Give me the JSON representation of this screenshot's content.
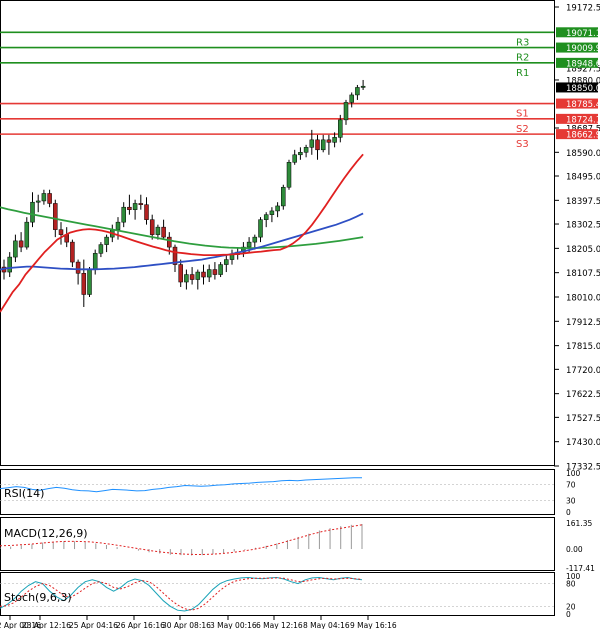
{
  "chart_data": {
    "type": "candlestick",
    "main": {
      "ylim": [
        17332.5,
        19172.5
      ],
      "y_ticks": [
        "19172.5",
        "18880.0",
        "18785.4",
        "18687.5",
        "18590.0",
        "18495.0",
        "18397.5",
        "18302.5",
        "18205.0",
        "18107.5",
        "18010.0",
        "17912.5",
        "17815.0",
        "17720.0",
        "17622.5",
        "17527.5",
        "17430.0",
        "17332.5"
      ],
      "current_price": "18850.0",
      "levels": [
        {
          "name": "R3",
          "value": 19071.1,
          "label": "19071.1",
          "color": "#1f8f1f",
          "text_color": "#1f8f1f"
        },
        {
          "name": "R2",
          "value": 19009.9,
          "label": "19009.9",
          "color": "#1f8f1f",
          "text_color": "#1f8f1f"
        },
        {
          "name": "R1",
          "value": 18948.6,
          "label": "18948.6",
          "color": "#1f8f1f",
          "text_color": "#1f8f1f"
        },
        {
          "name": "S1",
          "value": 18785.4,
          "label": "18785.4",
          "color": "#e53935",
          "text_color": "#e53935"
        },
        {
          "name": "S2",
          "value": 18724.1,
          "label": "18724.1",
          "color": "#e53935",
          "text_color": "#e53935"
        },
        {
          "name": "S3",
          "value": 18662.9,
          "label": "18662.9",
          "color": "#e53935",
          "text_color": "#e53935"
        }
      ],
      "extra_tick_labels": [
        "18927.5"
      ],
      "candles": [
        [
          18130,
          18160,
          18080,
          18110
        ],
        [
          18110,
          18190,
          18090,
          18170
        ],
        [
          18170,
          18260,
          18150,
          18235
        ],
        [
          18235,
          18270,
          18190,
          18210
        ],
        [
          18210,
          18330,
          18200,
          18310
        ],
        [
          18310,
          18430,
          18290,
          18390
        ],
        [
          18390,
          18420,
          18350,
          18395
        ],
        [
          18395,
          18440,
          18380,
          18425
        ],
        [
          18425,
          18440,
          18370,
          18385
        ],
        [
          18385,
          18400,
          18250,
          18280
        ],
        [
          18280,
          18310,
          18220,
          18260
        ],
        [
          18260,
          18290,
          18210,
          18230
        ],
        [
          18230,
          18240,
          18130,
          18150
        ],
        [
          18150,
          18160,
          18060,
          18105
        ],
        [
          18105,
          18160,
          17970,
          18020
        ],
        [
          18020,
          18130,
          18010,
          18120
        ],
        [
          18120,
          18200,
          18100,
          18185
        ],
        [
          18185,
          18230,
          18170,
          18220
        ],
        [
          18220,
          18260,
          18190,
          18250
        ],
        [
          18250,
          18300,
          18230,
          18280
        ],
        [
          18280,
          18330,
          18240,
          18310
        ],
        [
          18310,
          18390,
          18290,
          18370
        ],
        [
          18370,
          18420,
          18340,
          18360
        ],
        [
          18360,
          18400,
          18320,
          18385
        ],
        [
          18385,
          18420,
          18360,
          18380
        ],
        [
          18380,
          18410,
          18300,
          18320
        ],
        [
          18320,
          18340,
          18240,
          18260
        ],
        [
          18260,
          18300,
          18240,
          18290
        ],
        [
          18290,
          18320,
          18240,
          18250
        ],
        [
          18250,
          18270,
          18180,
          18210
        ],
        [
          18210,
          18220,
          18110,
          18140
        ],
        [
          18140,
          18160,
          18050,
          18070
        ],
        [
          18070,
          18120,
          18040,
          18100
        ],
        [
          18100,
          18130,
          18060,
          18080
        ],
        [
          18080,
          18120,
          18040,
          18110
        ],
        [
          18110,
          18140,
          18060,
          18090
        ],
        [
          18090,
          18140,
          18070,
          18120
        ],
        [
          18120,
          18150,
          18080,
          18100
        ],
        [
          18100,
          18150,
          18090,
          18140
        ],
        [
          18140,
          18180,
          18110,
          18160
        ],
        [
          18160,
          18200,
          18140,
          18180
        ],
        [
          18180,
          18210,
          18160,
          18190
        ],
        [
          18190,
          18230,
          18170,
          18210
        ],
        [
          18210,
          18250,
          18190,
          18230
        ],
        [
          18230,
          18260,
          18200,
          18250
        ],
        [
          18250,
          18330,
          18230,
          18320
        ],
        [
          18320,
          18350,
          18290,
          18340
        ],
        [
          18340,
          18370,
          18310,
          18355
        ],
        [
          18355,
          18390,
          18330,
          18375
        ],
        [
          18375,
          18460,
          18360,
          18450
        ],
        [
          18450,
          18560,
          18440,
          18550
        ],
        [
          18550,
          18600,
          18540,
          18580
        ],
        [
          18580,
          18610,
          18560,
          18590
        ],
        [
          18590,
          18620,
          18570,
          18610
        ],
        [
          18610,
          18680,
          18580,
          18640
        ],
        [
          18640,
          18660,
          18560,
          18600
        ],
        [
          18600,
          18660,
          18590,
          18640
        ],
        [
          18640,
          18660,
          18580,
          18630
        ],
        [
          18630,
          18670,
          18610,
          18650
        ],
        [
          18650,
          18740,
          18630,
          18720
        ],
        [
          18720,
          18800,
          18700,
          18790
        ],
        [
          18790,
          18830,
          18770,
          18820
        ],
        [
          18820,
          18860,
          18800,
          18850
        ],
        [
          18850,
          18880,
          18840,
          18855
        ]
      ],
      "sma_red": [
        17950,
        17990,
        18030,
        18060,
        18100,
        18130,
        18160,
        18190,
        18215,
        18240,
        18255,
        18268,
        18275,
        18280,
        18282,
        18280,
        18276,
        18270,
        18262,
        18254,
        18245,
        18236,
        18228,
        18220,
        18212,
        18205,
        18198,
        18192,
        18188,
        18185,
        18182,
        18180,
        18178,
        18178,
        18178,
        18179,
        18180,
        18182,
        18184,
        18187,
        18190,
        18192,
        18195,
        18198,
        18200,
        18210,
        18225,
        18245,
        18270,
        18300,
        18335,
        18372,
        18410,
        18448,
        18485,
        18520,
        18552,
        18582
      ],
      "sma_blue": [
        18120,
        18125,
        18128,
        18130,
        18132,
        18132,
        18130,
        18128,
        18126,
        18124,
        18123,
        18122,
        18121,
        18121,
        18121,
        18122,
        18123,
        18124,
        18126,
        18128,
        18130,
        18133,
        18136,
        18139,
        18142,
        18145,
        18148,
        18151,
        18154,
        18157,
        18160,
        18165,
        18170,
        18175,
        18180,
        18186,
        18192,
        18198,
        18205,
        18212,
        18220,
        18228,
        18236,
        18244,
        18252,
        18260,
        18268,
        18276,
        18284,
        18292,
        18300,
        18310,
        18320,
        18332,
        18345
      ],
      "sma_green": [
        18370,
        18362,
        18355,
        18348,
        18342,
        18336,
        18330,
        18324,
        18318,
        18312,
        18306,
        18300,
        18294,
        18288,
        18282,
        18276,
        18270,
        18264,
        18258,
        18252,
        18246,
        18240,
        18234,
        18229,
        18224,
        18220,
        18216,
        18213,
        18210,
        18208,
        18207,
        18206,
        18206,
        18207,
        18208,
        18210,
        18212,
        18214,
        18217,
        18220,
        18223,
        18227,
        18231,
        18235,
        18240,
        18245,
        18250
      ]
    },
    "rsi": {
      "label": "RSI(14)",
      "ticks": [
        "100",
        "70",
        "30",
        "0"
      ],
      "values": [
        60,
        62,
        65,
        63,
        58,
        56,
        60,
        63,
        61,
        57,
        55,
        54,
        52,
        55,
        58,
        57,
        56,
        54,
        55,
        58,
        60,
        63,
        65,
        68,
        67,
        66,
        67,
        69,
        70,
        72,
        73,
        74,
        76,
        77,
        78,
        80,
        81,
        80,
        82,
        83,
        84,
        85,
        86,
        87,
        88,
        88
      ]
    },
    "macd": {
      "label": "MACD(12,26,9)",
      "ticks": [
        "161.35",
        "0.00",
        "-117.41"
      ],
      "histogram": [
        10,
        15,
        22,
        30,
        40,
        45,
        50,
        48,
        42,
        35,
        25,
        12,
        0,
        -10,
        -20,
        -28,
        -35,
        -38,
        -40,
        -38,
        -32,
        -25,
        -15,
        -5,
        8,
        20,
        35,
        55,
        75,
        95,
        115,
        130,
        142,
        150,
        155
      ],
      "signal": [
        20,
        22,
        26,
        30,
        36,
        42,
        46,
        48,
        47,
        44,
        38,
        30,
        20,
        10,
        0,
        -10,
        -18,
        -25,
        -30,
        -33,
        -34,
        -32,
        -28,
        -22,
        -14,
        -4,
        8,
        22,
        38,
        56,
        74,
        92,
        108,
        120,
        130,
        140,
        150
      ]
    },
    "stoch": {
      "label": "Stoch(9,6,3)",
      "ticks": [
        "100",
        "80",
        "20",
        "0"
      ],
      "k": [
        15,
        25,
        40,
        60,
        75,
        85,
        80,
        60,
        45,
        35,
        50,
        70,
        85,
        90,
        85,
        70,
        60,
        70,
        85,
        92,
        88,
        75,
        55,
        35,
        20,
        10,
        8,
        12,
        25,
        45,
        65,
        80,
        88,
        92,
        95,
        96,
        94,
        93,
        95,
        96,
        92,
        85,
        80,
        90,
        95,
        96,
        93,
        90,
        94,
        96,
        92,
        90
      ],
      "d": [
        20,
        22,
        30,
        45,
        60,
        72,
        80,
        75,
        62,
        48,
        44,
        55,
        68,
        80,
        85,
        80,
        70,
        66,
        72,
        82,
        88,
        85,
        72,
        55,
        38,
        24,
        14,
        10,
        15,
        28,
        45,
        62,
        76,
        86,
        90,
        93,
        94,
        94,
        94,
        95,
        94,
        90,
        85,
        86,
        90,
        93,
        94,
        92,
        93,
        94,
        93,
        91
      ]
    },
    "x_labels": [
      "22 Apr 00:16",
      "23 Apr 12:16",
      "25 Apr 04:16",
      "26 Apr 16:16",
      "30 Apr 08:16",
      "3 May 00:16",
      "6 May 12:16",
      "8 May 04:16",
      "9 May 16:16"
    ]
  }
}
